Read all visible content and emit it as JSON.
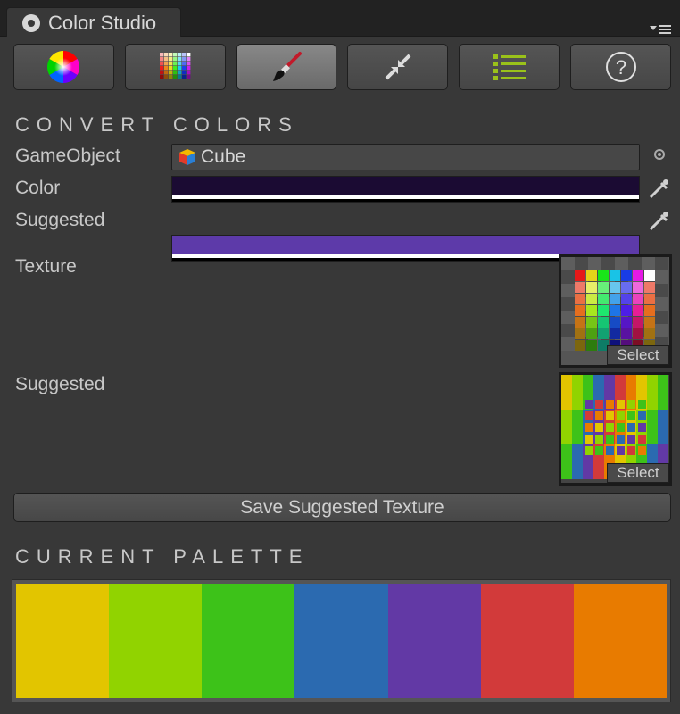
{
  "window": {
    "tab_title": "Color Studio"
  },
  "toolbar": {
    "buttons": [
      {
        "icon": "color-wheel-icon",
        "active": false
      },
      {
        "icon": "palette-grid-icon",
        "active": false
      },
      {
        "icon": "paint-brush-icon",
        "active": true
      },
      {
        "icon": "compress-arrows-icon",
        "active": false
      },
      {
        "icon": "list-icon",
        "active": false
      },
      {
        "icon": "help-icon",
        "active": false
      }
    ]
  },
  "convert": {
    "heading": "CONVERT COLORS",
    "gameobject_label": "GameObject",
    "gameobject_value": "Cube",
    "color_label": "Color",
    "color_value": "#1b0b33",
    "suggested_label": "Suggested",
    "suggested_value": "#5d3aa9",
    "texture_label": "Texture",
    "suggested_texture_label": "Suggested",
    "select_label": "Select",
    "save_button": "Save Suggested Texture"
  },
  "palette": {
    "heading": "CURRENT PALETTE",
    "colors": [
      "#e2c500",
      "#91d300",
      "#3dc219",
      "#2b6ab0",
      "#6239a5",
      "#d23a3a",
      "#e87b00"
    ]
  },
  "help_icon_glyph": "?"
}
